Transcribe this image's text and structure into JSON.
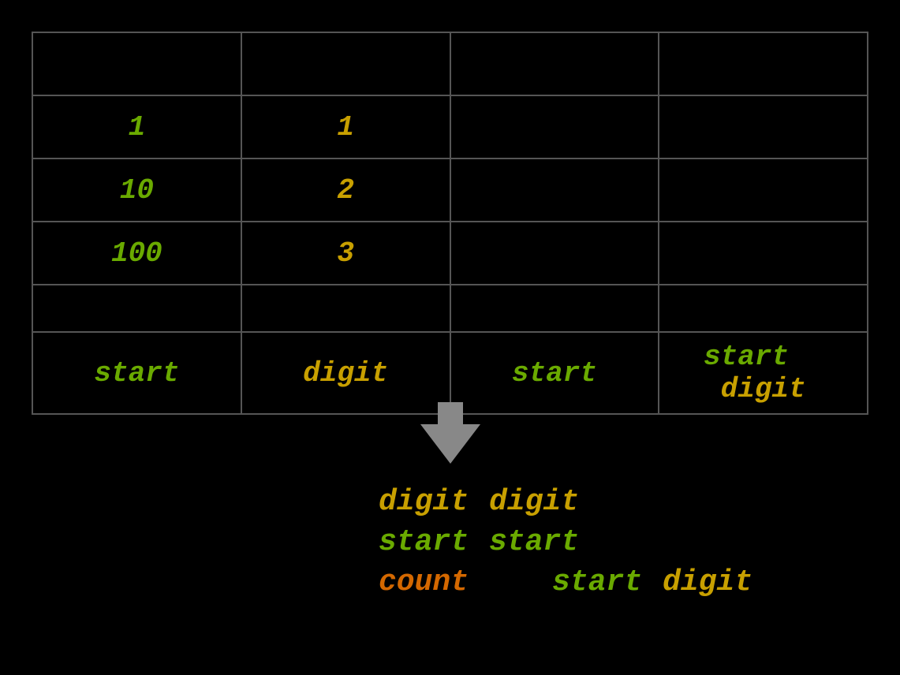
{
  "table": {
    "rows": [
      {
        "id": "header",
        "cells": [
          "",
          "",
          "",
          ""
        ]
      },
      {
        "id": "row2",
        "cells": [
          {
            "text": "1",
            "color": "green"
          },
          {
            "text": "1",
            "color": "yellow"
          },
          {
            "text": "",
            "color": ""
          },
          {
            "text": "",
            "color": ""
          }
        ]
      },
      {
        "id": "row3",
        "cells": [
          {
            "text": "10",
            "color": "green"
          },
          {
            "text": "2",
            "color": "yellow"
          },
          {
            "text": "",
            "color": ""
          },
          {
            "text": "",
            "color": ""
          }
        ]
      },
      {
        "id": "row4",
        "cells": [
          {
            "text": "100",
            "color": "green"
          },
          {
            "text": "3",
            "color": "yellow"
          },
          {
            "text": "",
            "color": ""
          },
          {
            "text": "",
            "color": ""
          }
        ]
      },
      {
        "id": "row5",
        "cells": [
          "",
          "",
          "",
          ""
        ]
      },
      {
        "id": "row6",
        "cells": [
          {
            "text": "start",
            "color": "green"
          },
          {
            "text": "digit",
            "color": "yellow"
          },
          {
            "text": "start",
            "color": "green"
          },
          {
            "text": "start  digit",
            "color": "mixed"
          }
        ]
      }
    ]
  },
  "bottom": {
    "row1": [
      {
        "text": "digit",
        "color": "yellow"
      },
      {
        "text": "digit",
        "color": "yellow"
      }
    ],
    "row2": [
      {
        "text": "start",
        "color": "green"
      },
      {
        "text": "start",
        "color": "green"
      }
    ],
    "row3": [
      {
        "text": "count",
        "color": "orange"
      },
      {
        "text": "start",
        "color": "green"
      },
      {
        "text": "digit",
        "color": "yellow"
      }
    ]
  }
}
